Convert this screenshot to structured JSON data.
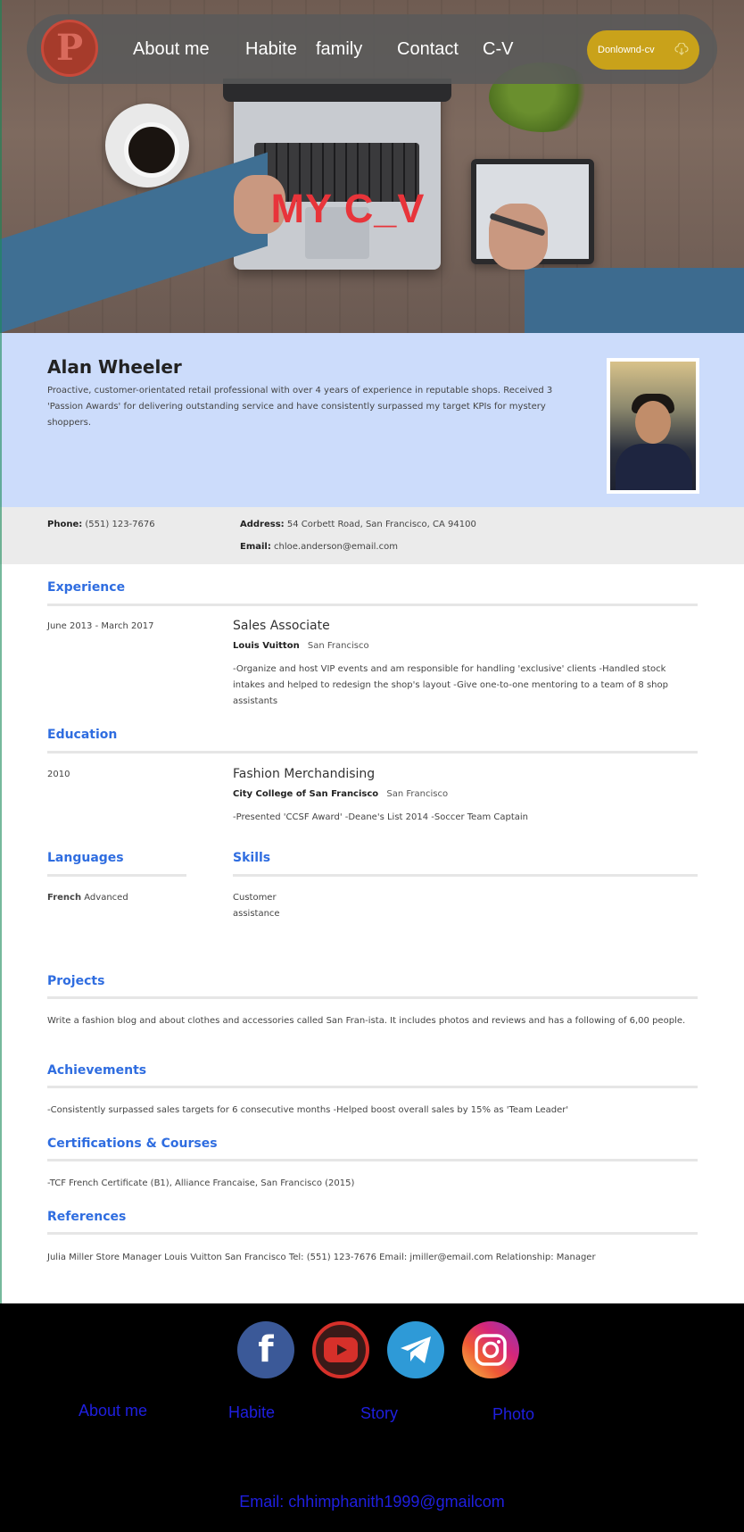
{
  "nav": {
    "logo_letter": "P",
    "links": [
      "About me",
      "Habite",
      "family",
      "Contact",
      "C-V"
    ],
    "download_label": "Donlownd-cv"
  },
  "hero": {
    "title": "MY C_V"
  },
  "profile": {
    "name": "Alan Wheeler",
    "summary": "Proactive, customer-orientated retail professional with over 4 years of experience in reputable shops. Received 3 'Passion Awards' for delivering outstanding service and have consistently surpassed my target KPIs for mystery shoppers."
  },
  "contact": {
    "phone_label": "Phone:",
    "phone": "(551) 123-7676",
    "address_label": "Address:",
    "address": "54 Corbett Road, San Francisco, CA 94100",
    "email_label": "Email:",
    "email": "chloe.anderson@email.com"
  },
  "experience": {
    "title": "Experience",
    "dates": "June 2013 - March 2017",
    "role": "Sales Associate",
    "company": "Louis Vuitton",
    "location": "San Francisco",
    "description": "-Organize and host VIP events and am responsible for handling 'exclusive' clients -Handled stock intakes and helped to redesign the shop's layout -Give one-to-one mentoring to a team of 8 shop assistants"
  },
  "education": {
    "title": "Education",
    "year": "2010",
    "degree": "Fashion Merchandising",
    "school": "City College of San Francisco",
    "location": "San Francisco",
    "description": "-Presented 'CCSF Award' -Deane's List 2014 -Soccer Team Captain"
  },
  "languages": {
    "title": "Languages",
    "language": "French",
    "level": "Advanced"
  },
  "skills": {
    "title": "Skills",
    "items": [
      "Customer",
      "assistance"
    ]
  },
  "projects": {
    "title": "Projects",
    "text": "Write a fashion blog and about clothes and accessories called San Fran-ista. It includes photos and reviews and has a following of 6,00 people."
  },
  "achievements": {
    "title": "Achievements",
    "text": "-Consistently surpassed sales targets for 6 consecutive months -Helped boost overall sales by 15% as 'Team Leader'"
  },
  "certifications": {
    "title": "Certifications & Courses",
    "text": "-TCF French Certificate (B1), Alliance Francaise, San Francisco (2015)"
  },
  "references": {
    "title": "References",
    "text": "Julia Miller Store Manager Louis Vuitton San Francisco Tel: (551) 123-7676 Email: jmiller@email.com Relationship: Manager"
  },
  "footer": {
    "links": [
      "About me",
      "Habite",
      "Story",
      "Photo"
    ],
    "email": "Email: chhimphanith1999@gmailcom",
    "social_icons": [
      "facebook-icon",
      "youtube-icon",
      "telegram-icon",
      "instagram-icon"
    ]
  },
  "colors": {
    "accent": "#2f6de0",
    "hero_title": "#e8343a",
    "download_button": "#c9a21a",
    "profile_bg": "#ccdcfb",
    "footer_link": "#1f1fe0"
  }
}
